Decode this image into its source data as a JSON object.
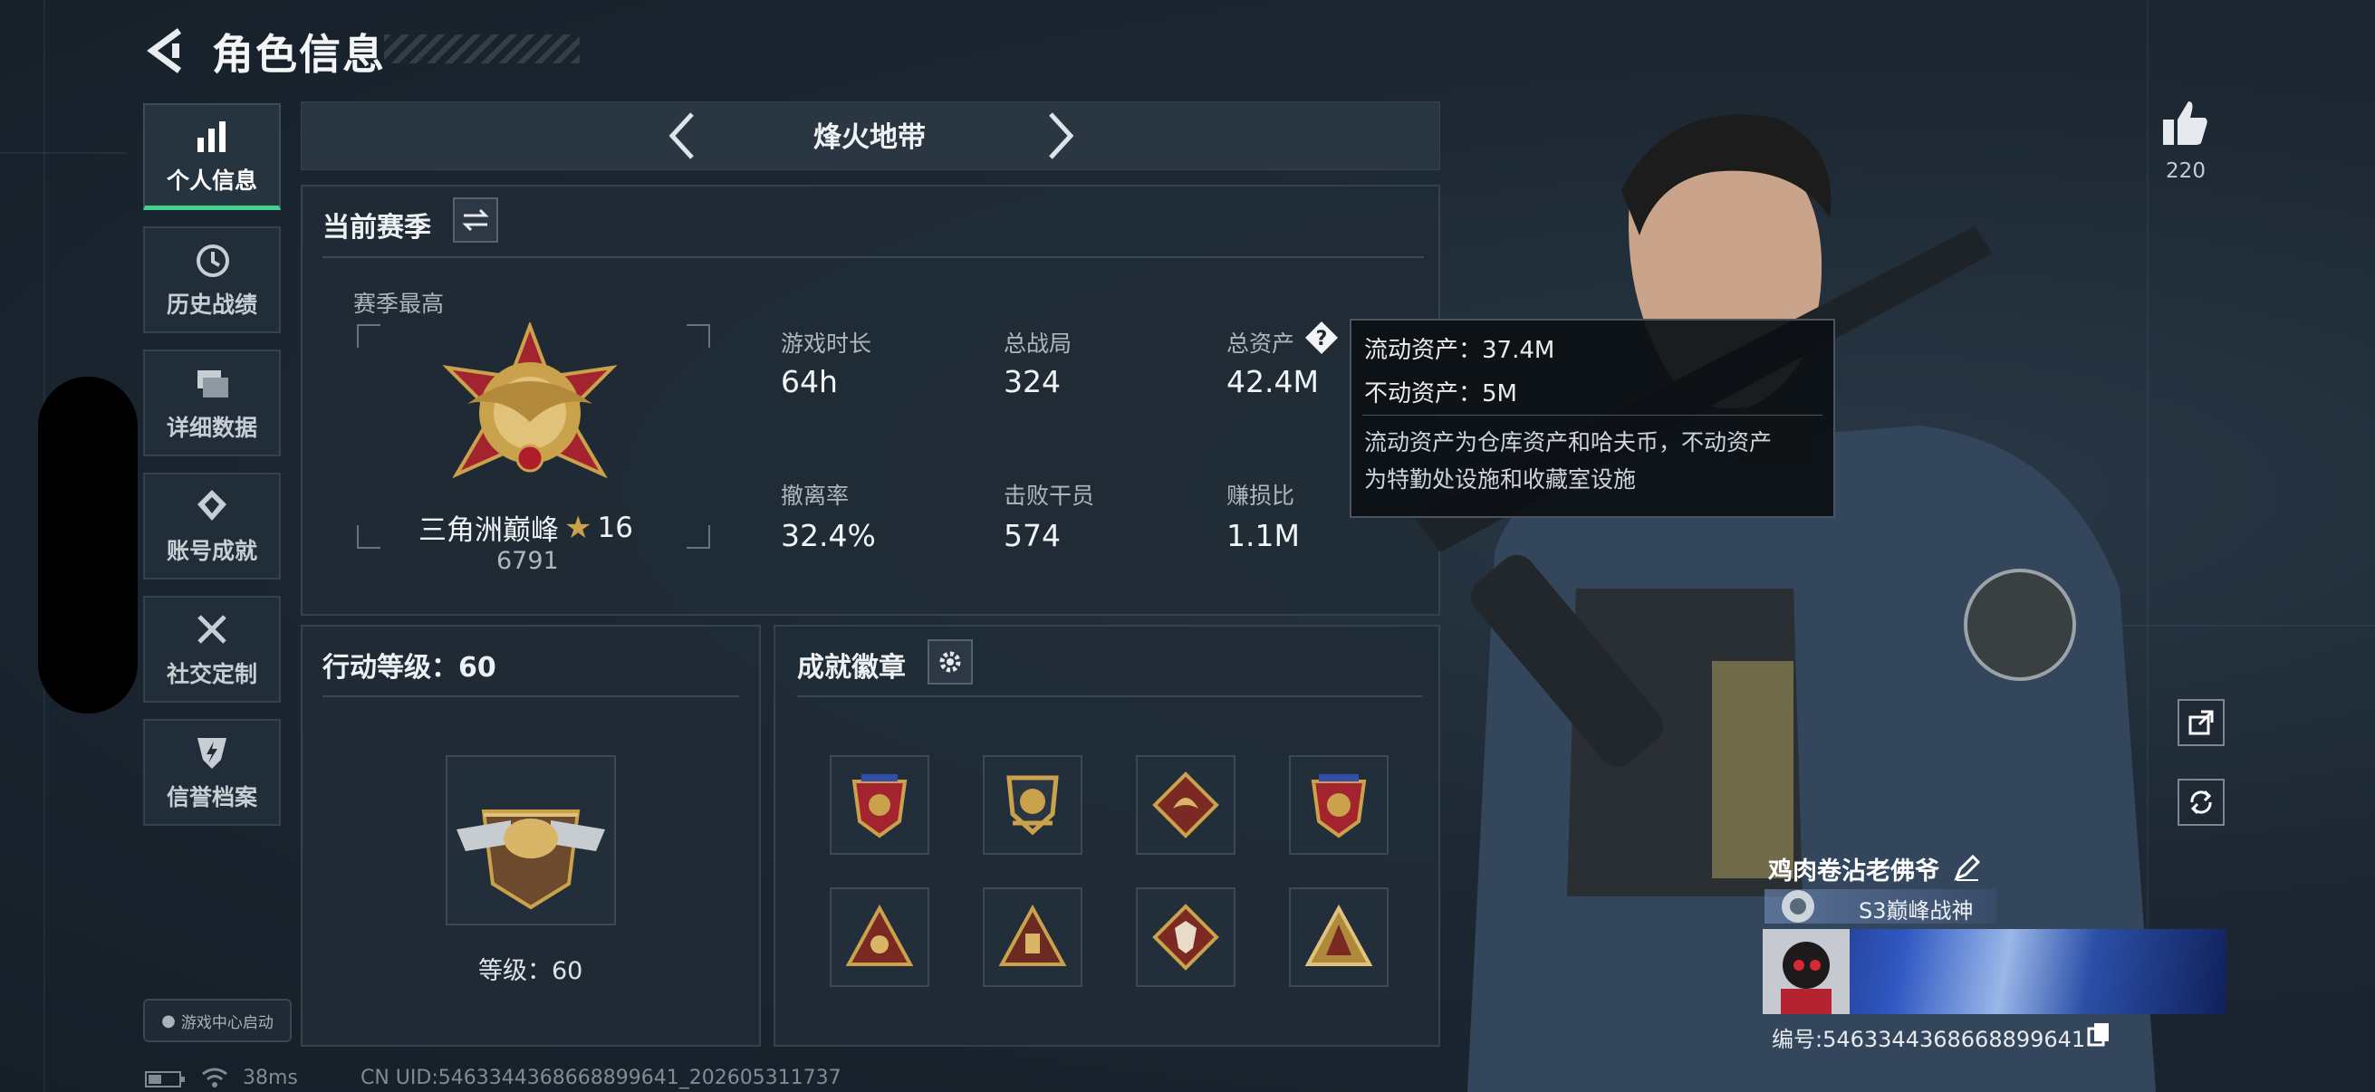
{
  "header": {
    "title": "角色信息"
  },
  "nav": [
    {
      "label": "个人信息",
      "icon": "bar-chart-icon",
      "active": true
    },
    {
      "label": "历史战绩",
      "icon": "history-clock-icon"
    },
    {
      "label": "详细数据",
      "icon": "folder-stack-icon"
    },
    {
      "label": "账号成就",
      "icon": "achievement-icon"
    },
    {
      "label": "社交定制",
      "icon": "wrench-tools-icon"
    },
    {
      "label": "信誉档案",
      "icon": "shield-bolt-icon"
    }
  ],
  "game_center_launch": "游戏中心启动",
  "mode": {
    "title": "烽火地带"
  },
  "season": {
    "title": "当前赛季",
    "highest_label": "赛季最高",
    "rank_name": "三角洲巅峰",
    "rank_stars": "16",
    "rank_points": "6791",
    "stats": [
      {
        "label": "游戏时长",
        "value": "64h"
      },
      {
        "label": "总战局",
        "value": "324"
      },
      {
        "label": "总资产",
        "value": "42.4M"
      },
      {
        "label": "撤离率",
        "value": "32.4%"
      },
      {
        "label": "击败干员",
        "value": "574"
      },
      {
        "label": "赚损比",
        "value": "1.1M"
      }
    ]
  },
  "tooltip": {
    "liquid": "流动资产：37.4M",
    "fixed": "不动资产：5M",
    "desc1": "流动资产为仓库资产和哈夫币，不动资产",
    "desc2": "为特勤处设施和收藏室设施"
  },
  "action_level": {
    "title": "行动等级：60",
    "level_text": "等级：60"
  },
  "achievements": {
    "title": "成就徽章"
  },
  "character": {
    "likes": "220",
    "player_name": "鸡肉卷沾老佛爷",
    "title": "S3巅峰战神",
    "uid_line": "编号:5463344368668899641"
  },
  "status_bar": {
    "ping": "38ms",
    "uid": "CN UID:5463344368668899641_202605311737"
  },
  "colors": {
    "accent_green": "#3fd38e",
    "background": "#1b2530"
  }
}
